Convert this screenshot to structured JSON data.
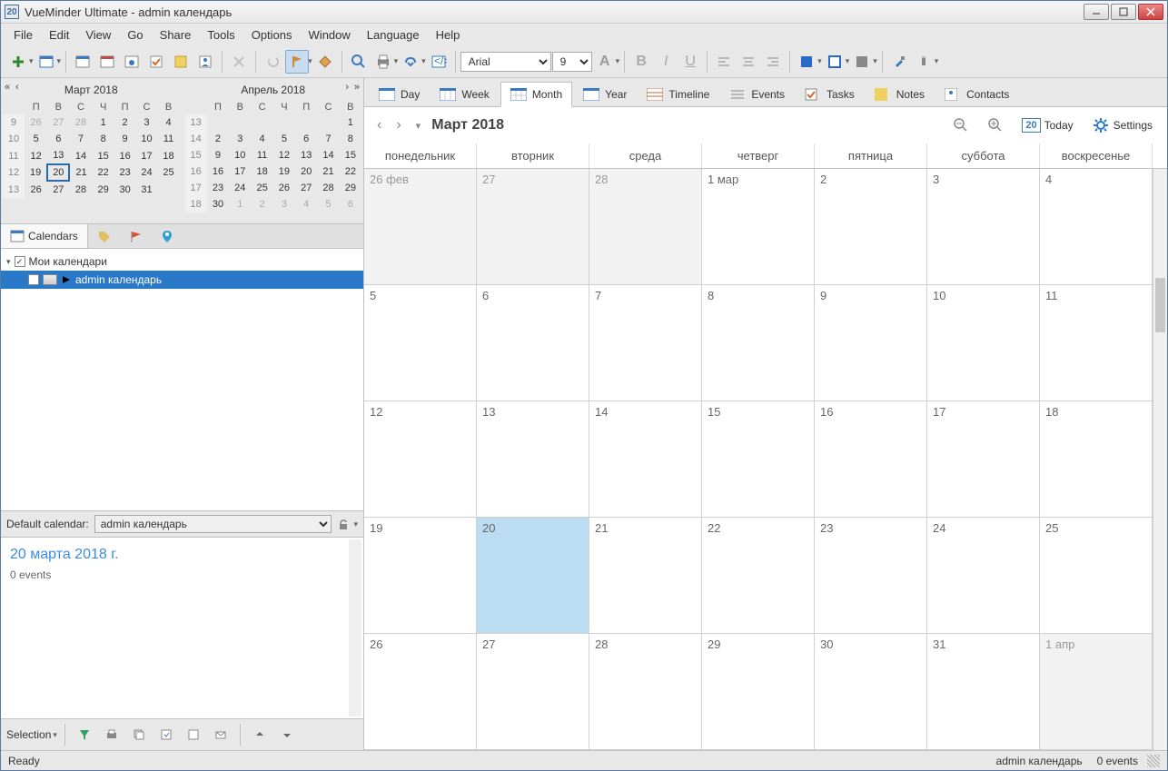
{
  "window": {
    "title": "VueMinder Ultimate - admin календарь",
    "icon": "20"
  },
  "menu": [
    "File",
    "Edit",
    "View",
    "Go",
    "Share",
    "Tools",
    "Options",
    "Window",
    "Language",
    "Help"
  ],
  "font": {
    "family": "Arial",
    "size": "9"
  },
  "minicals": {
    "left": {
      "title": "Март 2018",
      "dows": [
        "П",
        "В",
        "С",
        "Ч",
        "П",
        "С",
        "В"
      ],
      "rows": [
        {
          "wk": "9",
          "d": [
            "26",
            "27",
            "28",
            "1",
            "2",
            "3",
            "4"
          ],
          "otherStart": 3
        },
        {
          "wk": "10",
          "d": [
            "5",
            "6",
            "7",
            "8",
            "9",
            "10",
            "11"
          ]
        },
        {
          "wk": "11",
          "d": [
            "12",
            "13",
            "14",
            "15",
            "16",
            "17",
            "18"
          ]
        },
        {
          "wk": "12",
          "d": [
            "19",
            "20",
            "21",
            "22",
            "23",
            "24",
            "25"
          ],
          "today": 1
        },
        {
          "wk": "13",
          "d": [
            "26",
            "27",
            "28",
            "29",
            "30",
            "31",
            ""
          ]
        }
      ]
    },
    "right": {
      "title": "Апрель 2018",
      "dows": [
        "П",
        "В",
        "С",
        "Ч",
        "П",
        "С",
        "В"
      ],
      "rows": [
        {
          "wk": "13",
          "d": [
            "",
            "",
            "",
            "",
            "",
            "",
            "1"
          ]
        },
        {
          "wk": "14",
          "d": [
            "2",
            "3",
            "4",
            "5",
            "6",
            "7",
            "8"
          ]
        },
        {
          "wk": "15",
          "d": [
            "9",
            "10",
            "11",
            "12",
            "13",
            "14",
            "15"
          ]
        },
        {
          "wk": "16",
          "d": [
            "16",
            "17",
            "18",
            "19",
            "20",
            "21",
            "22"
          ]
        },
        {
          "wk": "17",
          "d": [
            "23",
            "24",
            "25",
            "26",
            "27",
            "28",
            "29"
          ]
        },
        {
          "wk": "18",
          "d": [
            "30",
            "1",
            "2",
            "3",
            "4",
            "5",
            "6"
          ],
          "otherFrom": 1
        }
      ]
    }
  },
  "sidetabs": {
    "calendars": "Calendars"
  },
  "tree": {
    "root": "Мои календари",
    "item": "admin календарь"
  },
  "defaultcal": {
    "label": "Default calendar:",
    "value": "admin календарь"
  },
  "detail": {
    "date": "20 марта 2018 г.",
    "sub": "0 events",
    "selection": "Selection"
  },
  "views": {
    "day": "Day",
    "week": "Week",
    "month": "Month",
    "year": "Year",
    "timeline": "Timeline",
    "events": "Events",
    "tasks": "Tasks",
    "notes": "Notes",
    "contacts": "Contacts"
  },
  "calheader": {
    "title": "Март 2018",
    "today": "Today",
    "settings": "Settings",
    "today_num": "20"
  },
  "dows": [
    "понедельник",
    "вторник",
    "среда",
    "четверг",
    "пятница",
    "суббота",
    "воскресенье"
  ],
  "weeks": [
    [
      {
        "t": "26 фев",
        "o": 1
      },
      {
        "t": "27",
        "o": 1
      },
      {
        "t": "28",
        "o": 1
      },
      {
        "t": "1 мар"
      },
      {
        "t": "2"
      },
      {
        "t": "3"
      },
      {
        "t": "4"
      }
    ],
    [
      {
        "t": "5"
      },
      {
        "t": "6"
      },
      {
        "t": "7"
      },
      {
        "t": "8"
      },
      {
        "t": "9"
      },
      {
        "t": "10"
      },
      {
        "t": "11"
      }
    ],
    [
      {
        "t": "12"
      },
      {
        "t": "13"
      },
      {
        "t": "14"
      },
      {
        "t": "15"
      },
      {
        "t": "16"
      },
      {
        "t": "17"
      },
      {
        "t": "18"
      }
    ],
    [
      {
        "t": "19"
      },
      {
        "t": "20",
        "today": 1
      },
      {
        "t": "21"
      },
      {
        "t": "22"
      },
      {
        "t": "23"
      },
      {
        "t": "24"
      },
      {
        "t": "25"
      }
    ],
    [
      {
        "t": "26"
      },
      {
        "t": "27"
      },
      {
        "t": "28"
      },
      {
        "t": "29"
      },
      {
        "t": "30"
      },
      {
        "t": "31"
      },
      {
        "t": "1 апр",
        "o": 1
      }
    ]
  ],
  "status": {
    "left": "Ready",
    "cal": "admin календарь",
    "events": "0 events"
  }
}
